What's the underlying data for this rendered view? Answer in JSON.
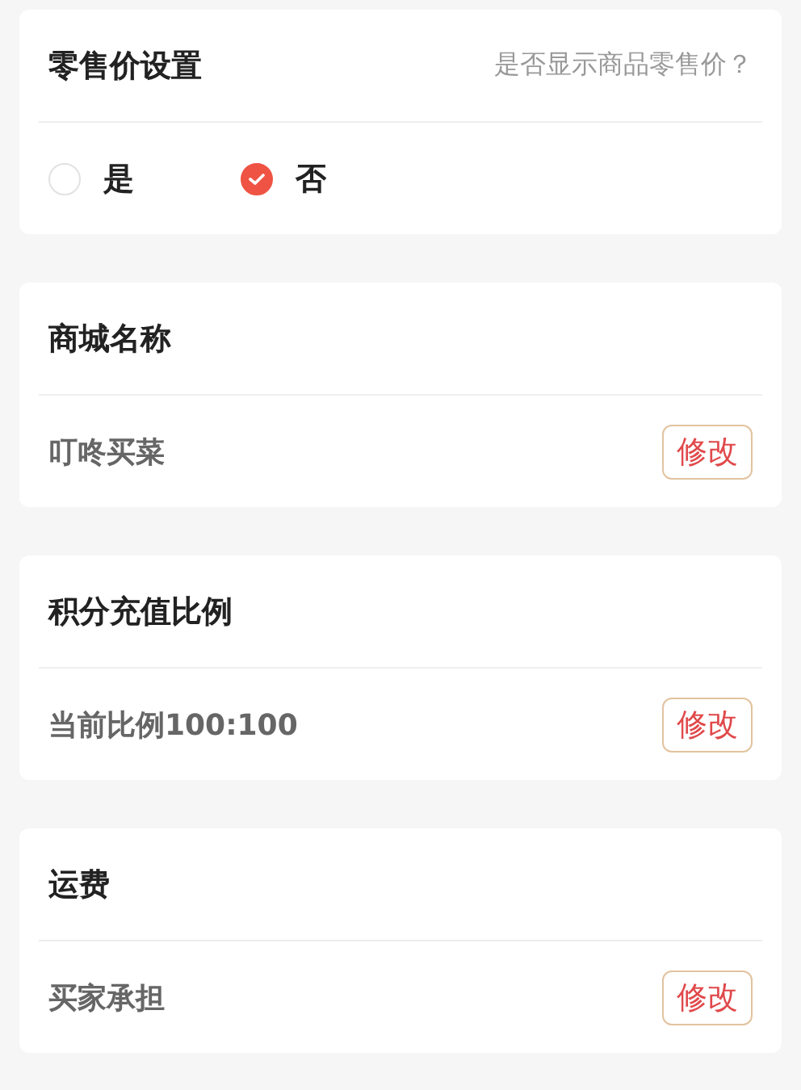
{
  "retail_price": {
    "title": "零售价设置",
    "hint": "是否显示商品零售价？",
    "options": [
      {
        "label": "是",
        "selected": false
      },
      {
        "label": "否",
        "selected": true
      }
    ]
  },
  "settings": [
    {
      "title": "商城名称",
      "value": "叮咚买菜",
      "button": "修改"
    },
    {
      "title": "积分充值比例",
      "value": "当前比例100:100",
      "button": "修改"
    },
    {
      "title": "运费",
      "value": "买家承担",
      "button": "修改"
    }
  ]
}
